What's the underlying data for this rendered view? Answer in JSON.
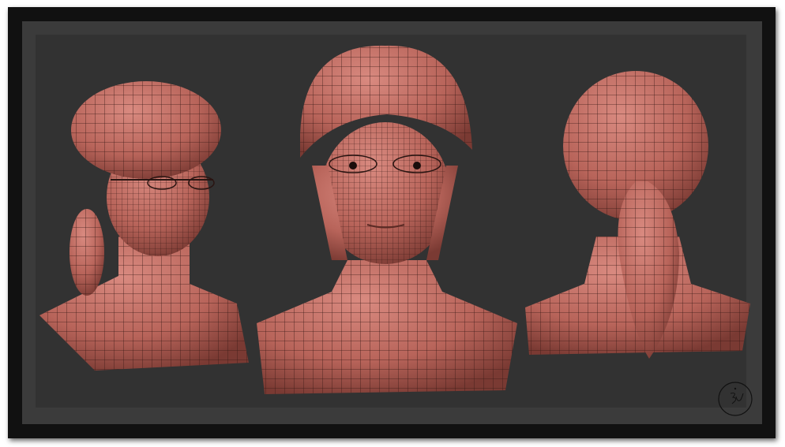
{
  "image": {
    "subject": "three-views-head-bust-wireframe",
    "views": [
      "three-quarter",
      "front",
      "back"
    ],
    "colors": {
      "frame": "#111111",
      "mat": "#3b3b3b",
      "panel": "#323232",
      "skin": "#b8645a",
      "skin_highlight": "#d98a80",
      "wire": "#3a1a16"
    }
  },
  "signature": {
    "text": "BJ",
    "icon": "signature-logo"
  }
}
